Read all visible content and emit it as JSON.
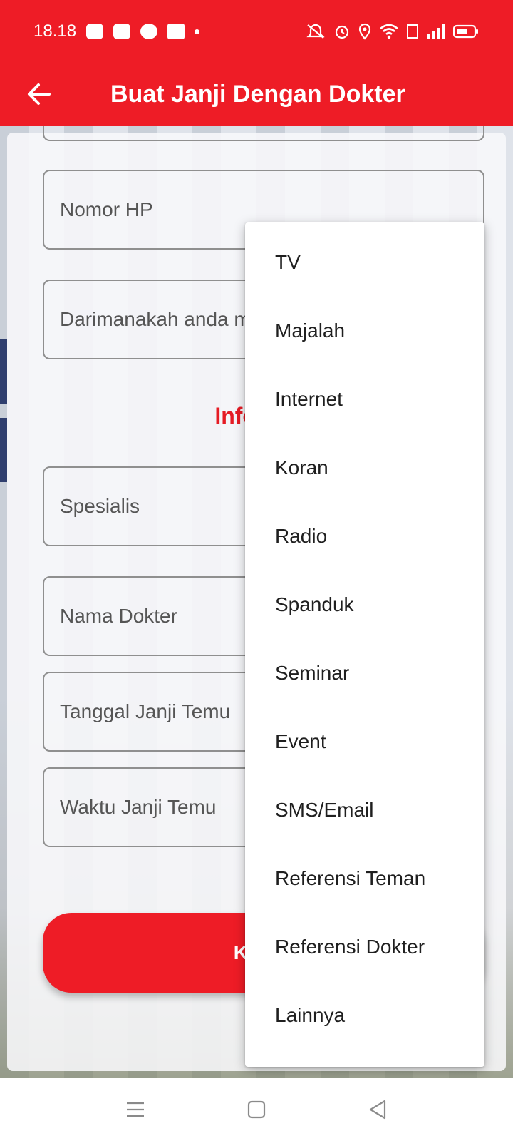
{
  "status_bar": {
    "time": "18.18",
    "left_icons": [
      "line-icon",
      "discord-icon",
      "chat-icon",
      "facebook-icon",
      "dot-icon"
    ],
    "right_icons": [
      "mute-icon",
      "alarm-icon",
      "location-icon",
      "wifi-icon",
      "volte-icon",
      "signal-icon",
      "battery-icon"
    ]
  },
  "app_bar": {
    "title": "Buat Janji Dengan Dokter"
  },
  "form": {
    "phone_placeholder": "Nomor HP",
    "source_placeholder": "Darimanakah anda m",
    "section_title": "Informa",
    "specialist_placeholder": "Spesialis",
    "doctor_placeholder": "Nama Dokter",
    "date_placeholder": "Tanggal Janji Temu",
    "time_placeholder": "Waktu Janji Temu",
    "submit_label": "Kon"
  },
  "dropdown": {
    "items": [
      "TV",
      "Majalah",
      "Internet",
      "Koran",
      "Radio",
      "Spanduk",
      "Seminar",
      "Event",
      "SMS/Email",
      "Referensi Teman",
      "Referensi Dokter",
      "Lainnya"
    ]
  },
  "colors": {
    "brand_red": "#ee1c26",
    "section_red": "#e51b24"
  }
}
